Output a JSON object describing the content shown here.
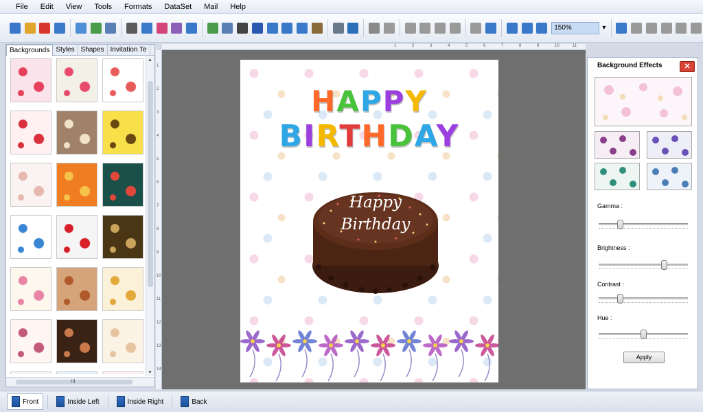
{
  "menu": [
    "File",
    "Edit",
    "View",
    "Tools",
    "Formats",
    "DataSet",
    "Mail",
    "Help"
  ],
  "toolbar": {
    "zoom_value": "150%",
    "icons": [
      "new-icon",
      "open-icon",
      "close-icon",
      "save-icon",
      "save-as-icon",
      "export-icon",
      "print-preview-icon",
      "print-icon",
      "copy-icon",
      "colors-icon",
      "line-icon",
      "pencil-icon",
      "image-icon",
      "watermark-icon",
      "barcode-icon",
      "text-icon",
      "rich-text-icon",
      "signature-icon",
      "email-icon",
      "database-icon",
      "dataset-icon",
      "undo-icon",
      "redo-icon",
      "cut-icon",
      "copy-format-icon",
      "paste-icon",
      "delete-icon",
      "bring-forward-icon",
      "send-backward-icon",
      "grid-icon",
      "actual-size-icon",
      "fit-icon",
      "zoom-in-icon",
      "zoom-out-icon",
      "lock-icon",
      "unlock-icon",
      "back-arrow-icon",
      "flip-icon",
      "forward-arrow-icon"
    ]
  },
  "left_panel": {
    "tabs": [
      "Backgrounds",
      "Styles",
      "Shapes",
      "Invitation Te"
    ],
    "active_tab": "Backgrounds",
    "hscroll_grip": "III"
  },
  "ruler": {
    "ticks": [
      "1",
      "2",
      "3",
      "4",
      "5",
      "6",
      "7",
      "8",
      "9",
      "10",
      "11"
    ],
    "vticks": [
      "1",
      "2",
      "3",
      "4",
      "5",
      "6",
      "7",
      "8",
      "9",
      "10",
      "11",
      "12",
      "13",
      "14"
    ]
  },
  "card": {
    "line1": "HAPPY",
    "line2": "BIRTHDAY",
    "cake_line1": "Happy",
    "cake_line2": "Birthday",
    "letter_colors": [
      "#ff6a2a",
      "#49c33b",
      "#2fa7e6",
      "#9b3fe0",
      "#f5b800",
      "#e23b3b"
    ]
  },
  "right_panel": {
    "title": "Background Effects",
    "close_label": "✕",
    "gamma_label": "Gamma :",
    "brightness_label": "Brightness :",
    "contrast_label": "Contrast :",
    "hue_label": "Hue :",
    "gamma": 0.22,
    "brightness": 0.75,
    "contrast": 0.22,
    "hue": 0.5,
    "apply_label": "Apply"
  },
  "bottom_tabs": [
    {
      "label": "Front",
      "active": true
    },
    {
      "label": "Inside Left",
      "active": false
    },
    {
      "label": "Inside Right",
      "active": false
    },
    {
      "label": "Back",
      "active": false
    }
  ]
}
